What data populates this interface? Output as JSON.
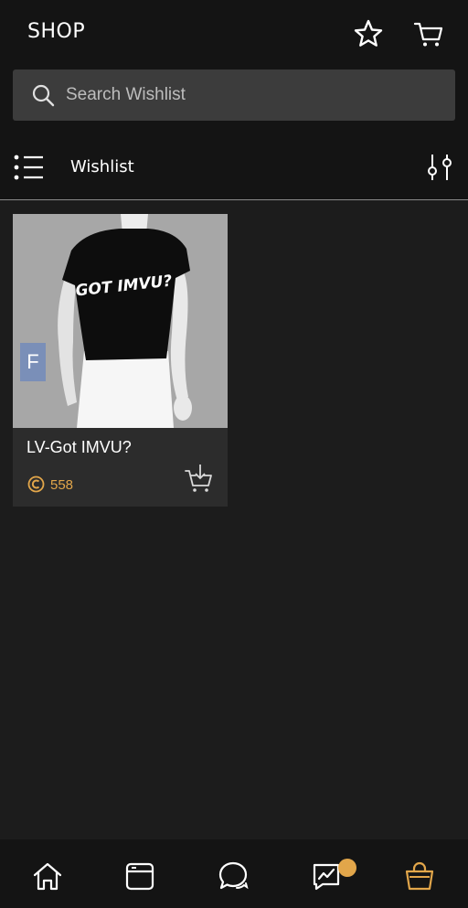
{
  "header": {
    "title": "SHOP",
    "icons": [
      "star-icon",
      "cart-icon"
    ]
  },
  "search": {
    "placeholder": "Search Wishlist",
    "value": ""
  },
  "toolbar": {
    "label": "Wishlist",
    "left_icon": "list-icon",
    "right_icon": "filter-icon"
  },
  "products": [
    {
      "title": "LV-Got IMVU?",
      "price": "558",
      "badge": "F",
      "shirt_text": "GOT IMVU?",
      "icons": [
        "credit-icon",
        "add-to-cart-icon"
      ]
    }
  ],
  "bottom_nav": {
    "items": [
      "home-icon",
      "browser-icon",
      "chat-icon",
      "activity-icon",
      "shop-bag-icon"
    ],
    "active": "shop-bag-icon",
    "notification_on": "activity-icon"
  },
  "colors": {
    "background": "#1c1c1c",
    "bar": "#141414",
    "search_field": "#3c3c3c",
    "card": "#2c2c2c",
    "accent": "#e2a64a",
    "badge": "#7a8fb8"
  }
}
